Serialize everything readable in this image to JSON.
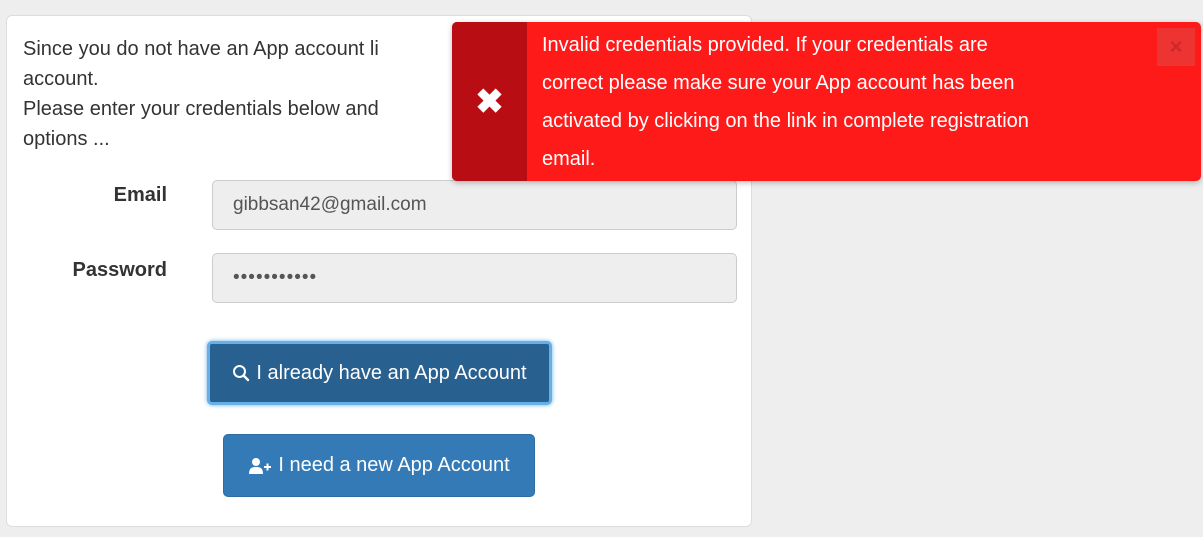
{
  "intro": {
    "line1": "Since you do not have an App account li",
    "line2": "account.",
    "line3": "Please enter your credentials below and",
    "line4": "options ..."
  },
  "form": {
    "email_label": "Email",
    "email_value": "gibbsan42@gmail.com",
    "password_label": "Password",
    "password_value": "•••••••••••"
  },
  "buttons": {
    "login_label": "I already have an App Account",
    "login_icon": "search-icon",
    "new_label": "I need a new App Account",
    "new_icon": "add-user-icon"
  },
  "alert": {
    "line1": "Invalid credentials provided. If your credentials are",
    "line2": "correct please make sure your App account has been",
    "line3": "activated by clicking on the link in complete registration",
    "line4": "email.",
    "icon": "close-icon",
    "close_glyph": "×",
    "icon_glyph": "✖",
    "background_color": "#ff1a1a",
    "icon_panel_color": "#b80d12"
  },
  "colors": {
    "primary_button": "#337ab7",
    "primary_button_active": "#286090",
    "focus_ring": "#66afe9"
  }
}
